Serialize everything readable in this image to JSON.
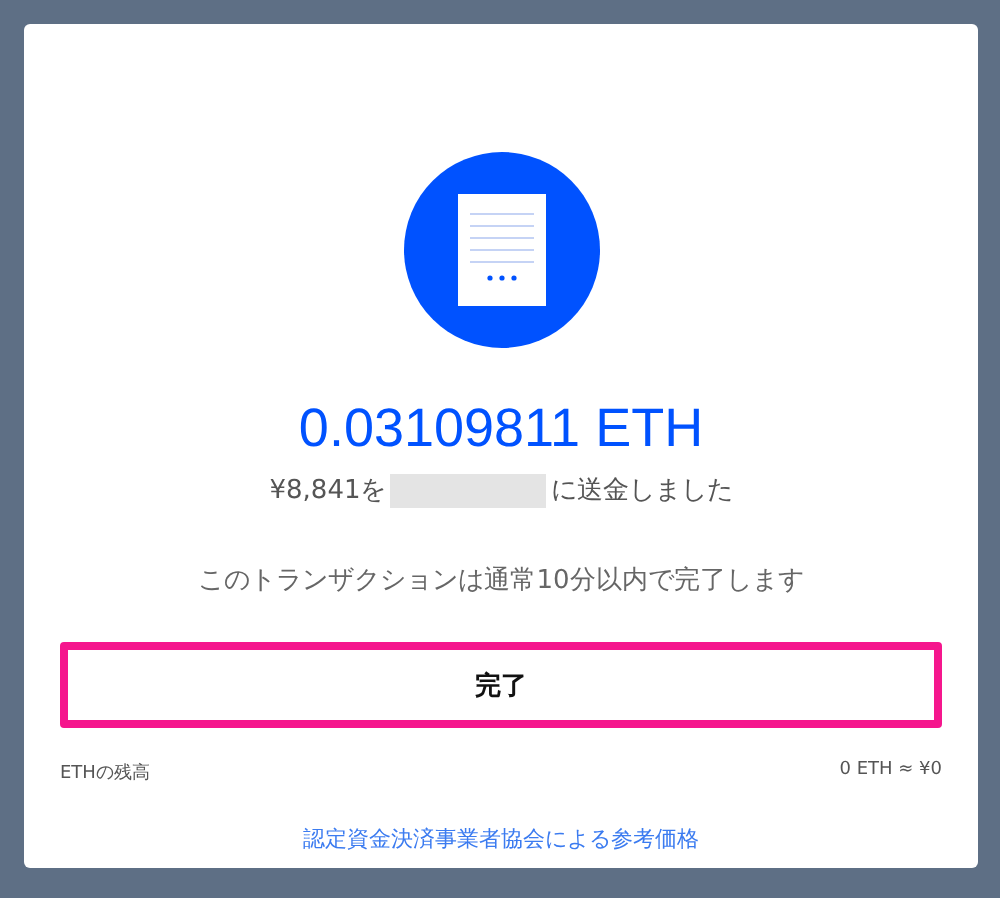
{
  "amount": "0.03109811 ETH",
  "sent": {
    "prefix": "¥8,841を",
    "suffix": "に送金しました"
  },
  "notice": "このトランザクションは通常10分以内で完了します",
  "done_button": {
    "label": "完了",
    "highlighted": true
  },
  "balance": {
    "label": "ETHの残高",
    "value": "0 ETH ≈ ¥0"
  },
  "reference_link": "認定資金決済事業者協会による参考価格"
}
